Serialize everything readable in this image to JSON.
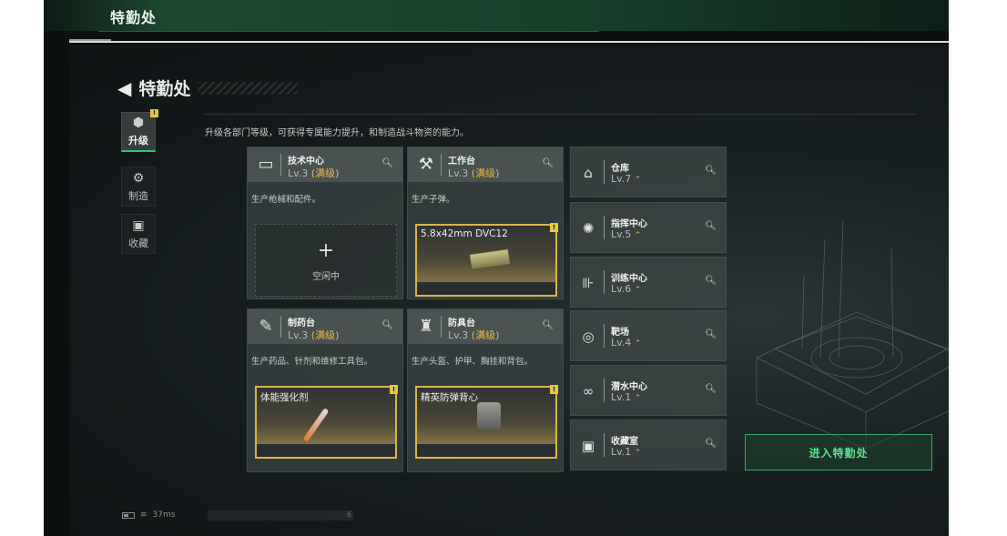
{
  "header": {
    "title": "特勤处"
  },
  "page": {
    "back_icon": "back-arrow-icon",
    "title": "特勤处"
  },
  "sidebar": {
    "items": [
      {
        "label": "升级",
        "icon": "upgrade-icon",
        "active": true,
        "badge": "!"
      },
      {
        "label": "制造",
        "icon": "craft-icon",
        "active": false
      },
      {
        "label": "收藏",
        "icon": "collection-icon",
        "active": false
      }
    ]
  },
  "description": "升级各部门等级，可获得专属能力提升，和制造战斗物资的能力。",
  "facilities": [
    {
      "name": "技术中心",
      "level": "Lv.3",
      "status": "(满级)",
      "desc": "生产枪械和配件。",
      "slot_type": "empty",
      "slot_icon": "+",
      "slot_label": "空闲中",
      "icon": "tech-center-icon"
    },
    {
      "name": "工作台",
      "level": "Lv.3",
      "status": "(满级)",
      "desc": "生产子弹。",
      "slot_type": "item",
      "slot_label": "5.8x42mm DVC12",
      "badge": "!",
      "icon": "workbench-icon"
    },
    {
      "name": "制药台",
      "level": "Lv.3",
      "status": "(满级)",
      "desc": "生产药品、针剂和维修工具包。",
      "slot_type": "item",
      "slot_label": "体能强化剂",
      "badge": "!",
      "icon": "pharmacy-icon"
    },
    {
      "name": "防具台",
      "level": "Lv.3",
      "status": "(满级)",
      "desc": "生产头盔、护甲、胸挂和背包。",
      "slot_type": "item",
      "slot_label": "精英防弹背心",
      "badge": "!",
      "icon": "armor-bench-icon"
    }
  ],
  "rooms": [
    {
      "name": "仓库",
      "level": "Lv.7",
      "icon": "storage-icon"
    },
    {
      "name": "指挥中心",
      "level": "Lv.5",
      "icon": "command-center-icon"
    },
    {
      "name": "训练中心",
      "level": "Lv.6",
      "icon": "training-center-icon"
    },
    {
      "name": "靶场",
      "level": "Lv.4",
      "icon": "shooting-range-icon"
    },
    {
      "name": "潜水中心",
      "level": "Lv.1",
      "icon": "diving-center-icon"
    },
    {
      "name": "收藏室",
      "level": "Lv.1",
      "icon": "collection-room-icon"
    }
  ],
  "enter_button": "进入特勤处",
  "status": {
    "ping": "37ms",
    "version": "6"
  },
  "colors": {
    "accent_green": "#36a868",
    "max_level": "#e8b94a",
    "item_border": "#d8b64a"
  }
}
